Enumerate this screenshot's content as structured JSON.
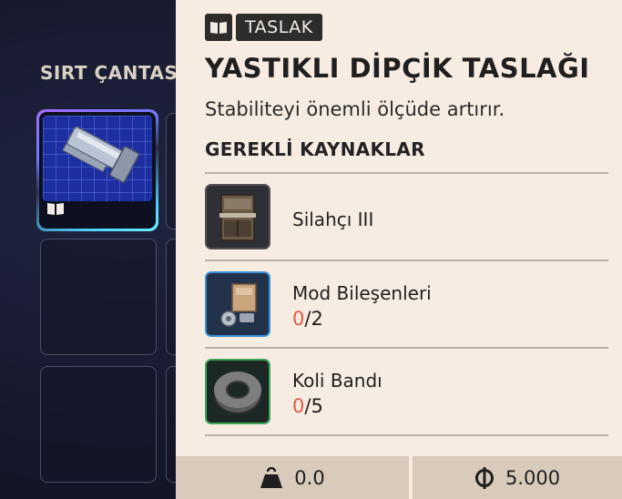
{
  "inventory": {
    "section_title": "SIRT ÇANTASI"
  },
  "tooltip": {
    "tag_icon": "book-icon",
    "tag_label": "TASLAK",
    "title": "YASTIKLI DİPÇİK TASLAĞI",
    "description": "Stabiliteyi önemli ölçüde artırır.",
    "requirements_title": "GEREKLİ KAYNAKLAR",
    "requirements": [
      {
        "name": "Silahçı III",
        "icon": "workbench-icon",
        "have": null,
        "need": null,
        "border": "#555055"
      },
      {
        "name": "Mod Bileşenleri",
        "icon": "mod-components-icon",
        "have": "0",
        "need": "/2",
        "border": "#3a8fd6"
      },
      {
        "name": "Koli Bandı",
        "icon": "duct-tape-icon",
        "have": "0",
        "need": "/5",
        "border": "#3fa65a"
      }
    ],
    "footer": {
      "weight_icon": "weight-icon",
      "weight": "0.0",
      "price_icon": "currency-icon",
      "price": "5.000"
    }
  },
  "colors": {
    "panel_bg": "#f7ece2",
    "accent_red": "#e05b45",
    "footer_bg": "#d8cbbb",
    "app_bg": "#15172a"
  }
}
